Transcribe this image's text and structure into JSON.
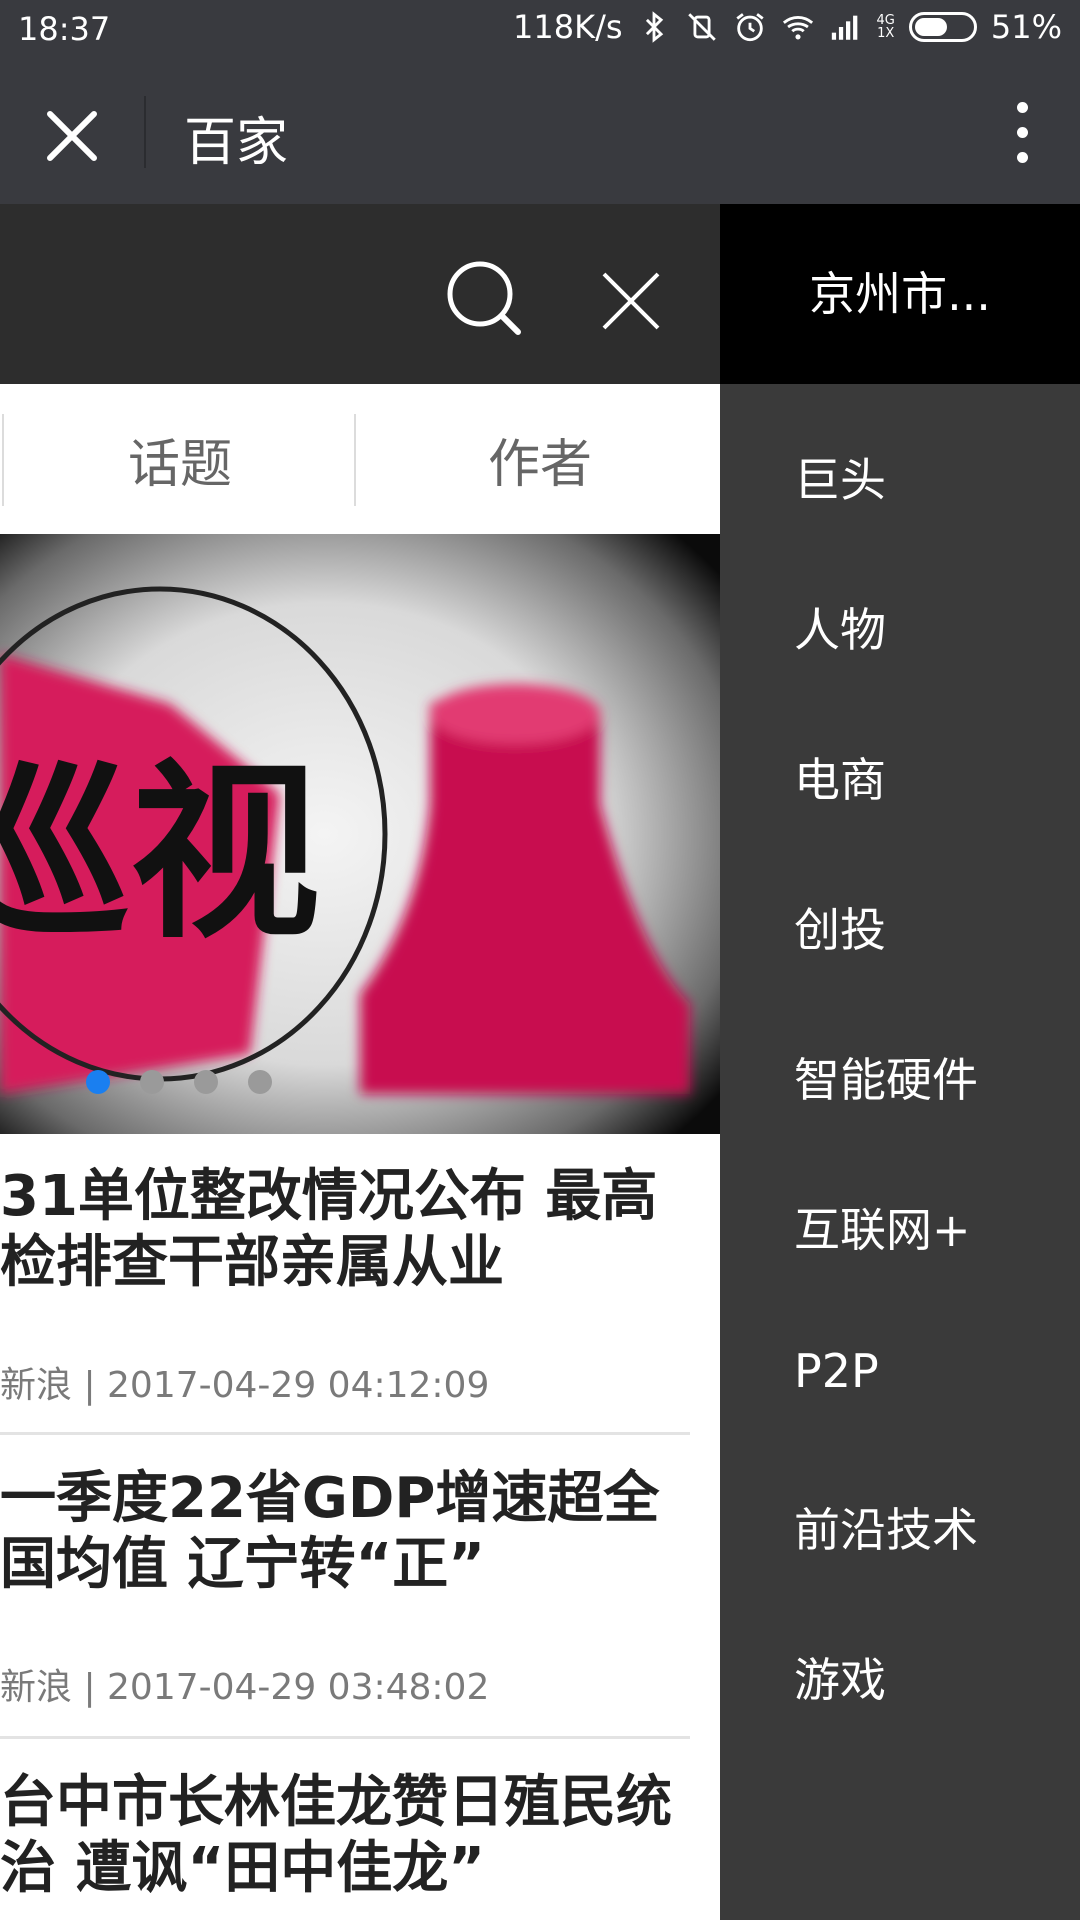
{
  "status_bar": {
    "time": "18:37",
    "net_speed": "118K/s",
    "network_top": "4G",
    "network_bottom": "1X",
    "battery": "51%",
    "battery_level": 0.51,
    "icons": [
      "bluetooth-icon",
      "vibrate-off-icon",
      "alarm-icon",
      "wifi-icon",
      "signal-icon",
      "battery-icon"
    ]
  },
  "titlebar": {
    "title": "百家"
  },
  "tabs": [
    {
      "label": "话题"
    },
    {
      "label": "作者"
    }
  ],
  "banner": {
    "overlay_text": "巡视",
    "slide_count": 4,
    "active_slide": 1
  },
  "articles": [
    {
      "title": "31单位整改情况公布 最高检排查干部亲属从业",
      "meta": "新浪 | 2017-04-29 04:12:09"
    },
    {
      "title": "一季度22省GDP增速超全国均值 辽宁转“正”",
      "meta": "新浪 | 2017-04-29 03:48:02"
    },
    {
      "title": "台中市长林佳龙赞日殖民统治 遭讽“田中佳龙”",
      "meta": ""
    }
  ],
  "drawer": {
    "header": "京州市...",
    "items": [
      "巨头",
      "人物",
      "电商",
      "创投",
      "智能硬件",
      "互联网+",
      "P2P",
      "前沿技术",
      "游戏"
    ]
  },
  "colors": {
    "statusbar_bg": "#393a3f",
    "searchbar_bg": "#2d2d2d",
    "drawer_bg": "#3a3a3a",
    "drawer_header_bg": "#000000",
    "active_dot": "#1a7ff0"
  }
}
